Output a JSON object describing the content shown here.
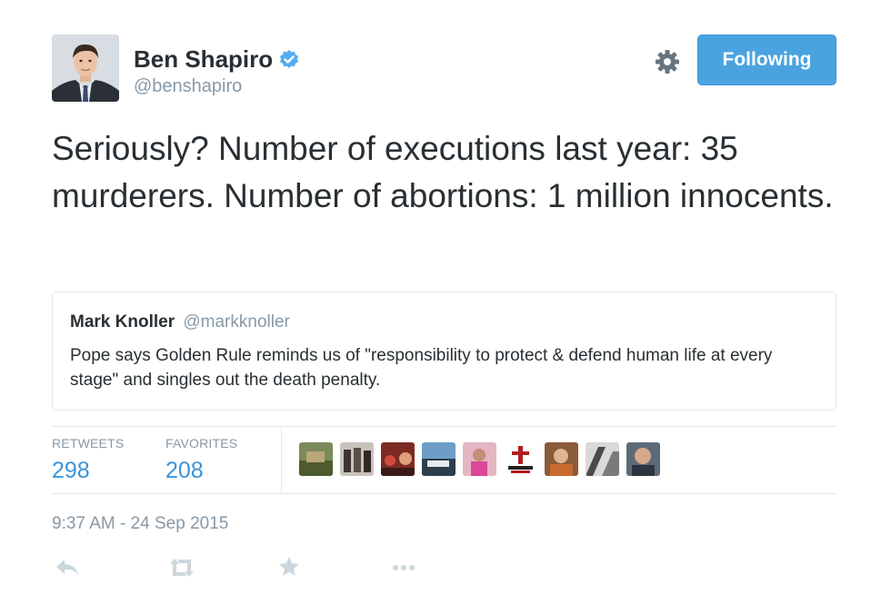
{
  "author": {
    "name": "Ben Shapiro",
    "handle": "@benshapiro",
    "verified": true
  },
  "header": {
    "follow_button_label": "Following",
    "settings_icon": "gear-icon"
  },
  "tweet": {
    "text": "Seriously? Number of executions last year: 35 murderers. Number of abortions: 1 million innocents."
  },
  "quoted_tweet": {
    "author_name": "Mark Knoller",
    "author_handle": "@markknoller",
    "text": "Pope says Golden Rule reminds us of \"responsibility to protect & defend human life at every stage\" and singles out the death penalty."
  },
  "stats": {
    "retweets_label": "RETWEETS",
    "retweets_count": "298",
    "favorites_label": "FAVORITES",
    "favorites_count": "208"
  },
  "favoriters_count_shown": 9,
  "timestamp": "9:37 AM - 24 Sep 2015",
  "actions": [
    "reply-icon",
    "retweet-icon",
    "favorite-icon",
    "more-icon"
  ],
  "colors": {
    "accent": "#4aa3df",
    "link": "#3b94d9",
    "muted": "#8899a6",
    "text": "#292f33",
    "border": "#e1e8ed",
    "icon": "#ccd6dd"
  }
}
